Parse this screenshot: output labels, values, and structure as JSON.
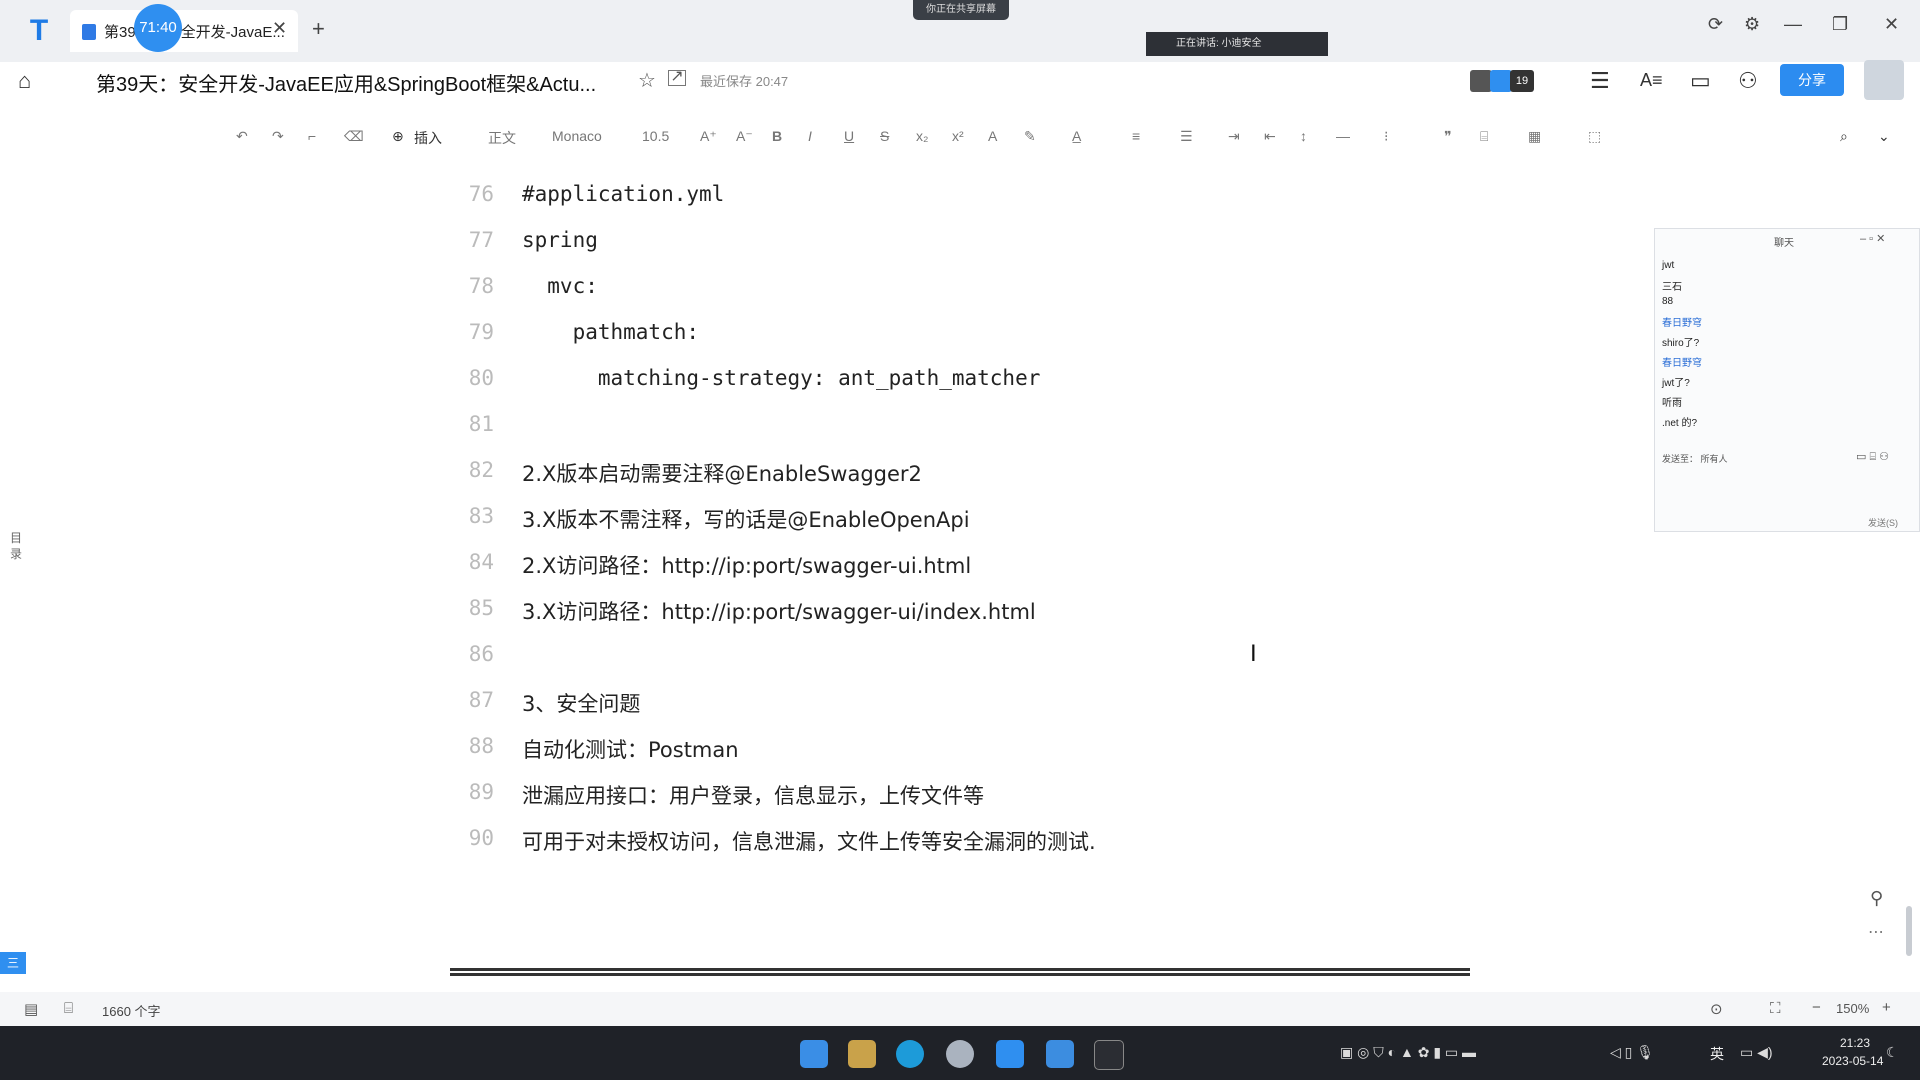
{
  "window": {
    "tab_title": "第39天：安全开发-JavaE...",
    "timer": "71:40",
    "share_banner": "你正在共享屏幕",
    "speaking_banner": "正在讲话: 小迪安全",
    "controls": [
      "⟳",
      "⚙",
      "—",
      "❐",
      "✕"
    ]
  },
  "doc": {
    "title": "第39天：安全开发-JavaEE应用&SpringBoot框架&Actu...",
    "saved_status": "最近保存 20:47",
    "collaborator_count": "19",
    "share_label": "分享"
  },
  "toolbar": {
    "insert_label": "插入",
    "style_label": "正文",
    "font_label": "Monaco",
    "size_label": "10.5"
  },
  "editor": {
    "lines": [
      {
        "num": "76",
        "text": "#application.yml"
      },
      {
        "num": "77",
        "text": "spring"
      },
      {
        "num": "78",
        "text": "  mvc:"
      },
      {
        "num": "79",
        "text": "    pathmatch:"
      },
      {
        "num": "80",
        "text": "      matching-strategy: ant_path_matcher"
      },
      {
        "num": "81",
        "text": ""
      },
      {
        "num": "82",
        "text": "2.X版本启动需要注释@EnableSwagger2"
      },
      {
        "num": "83",
        "text": "3.X版本不需注释，写的话是@EnableOpenApi"
      },
      {
        "num": "84",
        "text": "2.X访问路径：http://ip:port/swagger-ui.html"
      },
      {
        "num": "85",
        "text": "3.X访问路径：http://ip:port/swagger-ui/index.html"
      },
      {
        "num": "86",
        "text": ""
      },
      {
        "num": "87",
        "text": "3、安全问题"
      },
      {
        "num": "88",
        "text": "自动化测试：Postman"
      },
      {
        "num": "89",
        "text": "泄漏应用接口：用户登录，信息显示，上传文件等"
      },
      {
        "num": "90",
        "text": "可用于对未授权访问，信息泄漏，文件上传等安全漏洞的测试."
      }
    ]
  },
  "chat": {
    "title": "聊天",
    "messages": [
      {
        "text": "jwt",
        "blue": false
      },
      {
        "text": "三石",
        "blue": false
      },
      {
        "text": "88",
        "blue": false
      },
      {
        "text": "春日野穹",
        "blue": true
      },
      {
        "text": "shiro了?",
        "blue": false
      },
      {
        "text": "春日野穹",
        "blue": true
      },
      {
        "text": "jwt了?",
        "blue": false
      },
      {
        "text": "听雨",
        "blue": false
      },
      {
        "text": ".net 的?",
        "blue": false
      }
    ],
    "send_to": "发送至：  所有人",
    "send_label": "发送(S)"
  },
  "sidebar": {
    "outline_label": "目录",
    "outline_btn": "三"
  },
  "status": {
    "word_count": "1660 个字",
    "zoom": "150%"
  },
  "taskbar": {
    "ime": "英",
    "time": "21:23",
    "date": "2023-05-14"
  }
}
